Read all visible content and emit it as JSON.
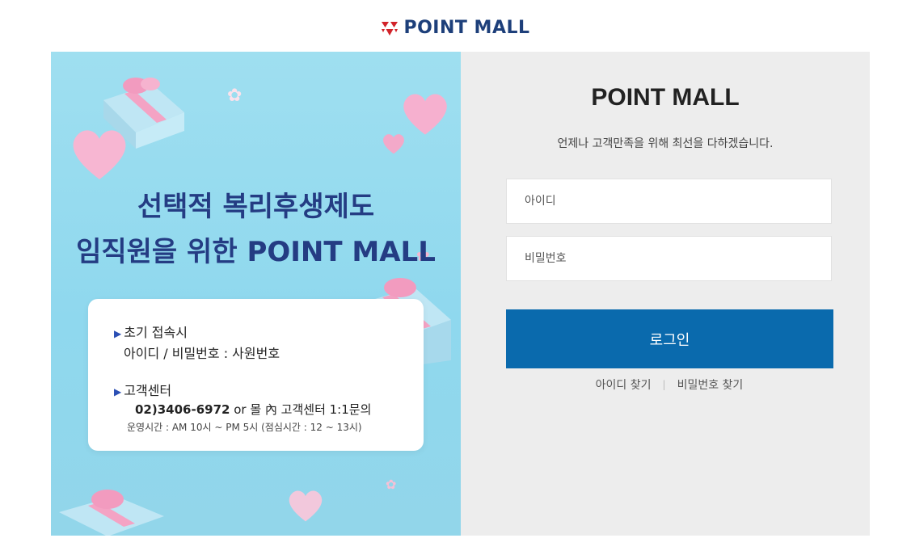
{
  "header": {
    "brand": "POINT MALL",
    "brand_color": "#1d3f7a",
    "mark_color": "#d2232a"
  },
  "banner": {
    "title_line1": "선택적 복리후생제도",
    "title_line2": "임직원을 위한 POINT MALL",
    "initial_access_heading": "초기 접속시",
    "initial_access_text": "아이디 / 비밀번호 : 사원번호",
    "support_heading": "고객센터",
    "support_phone": "02)3406-6972",
    "support_or": " or 몰 內 고객센터 1:1문의",
    "support_hours": "운영시간 : AM 10시 ~ PM 5시 (점심시간 : 12 ~ 13시)"
  },
  "login": {
    "title": "POINT MALL",
    "subtitle": "언제나 고객만족을 위해 최선을 다하겠습니다.",
    "id_placeholder": "아이디",
    "pw_placeholder": "비밀번호",
    "submit_label": "로그인",
    "find_id_label": "아이디 찾기",
    "separator": "|",
    "find_pw_label": "비밀번호 찾기",
    "button_color": "#0a6aad"
  }
}
